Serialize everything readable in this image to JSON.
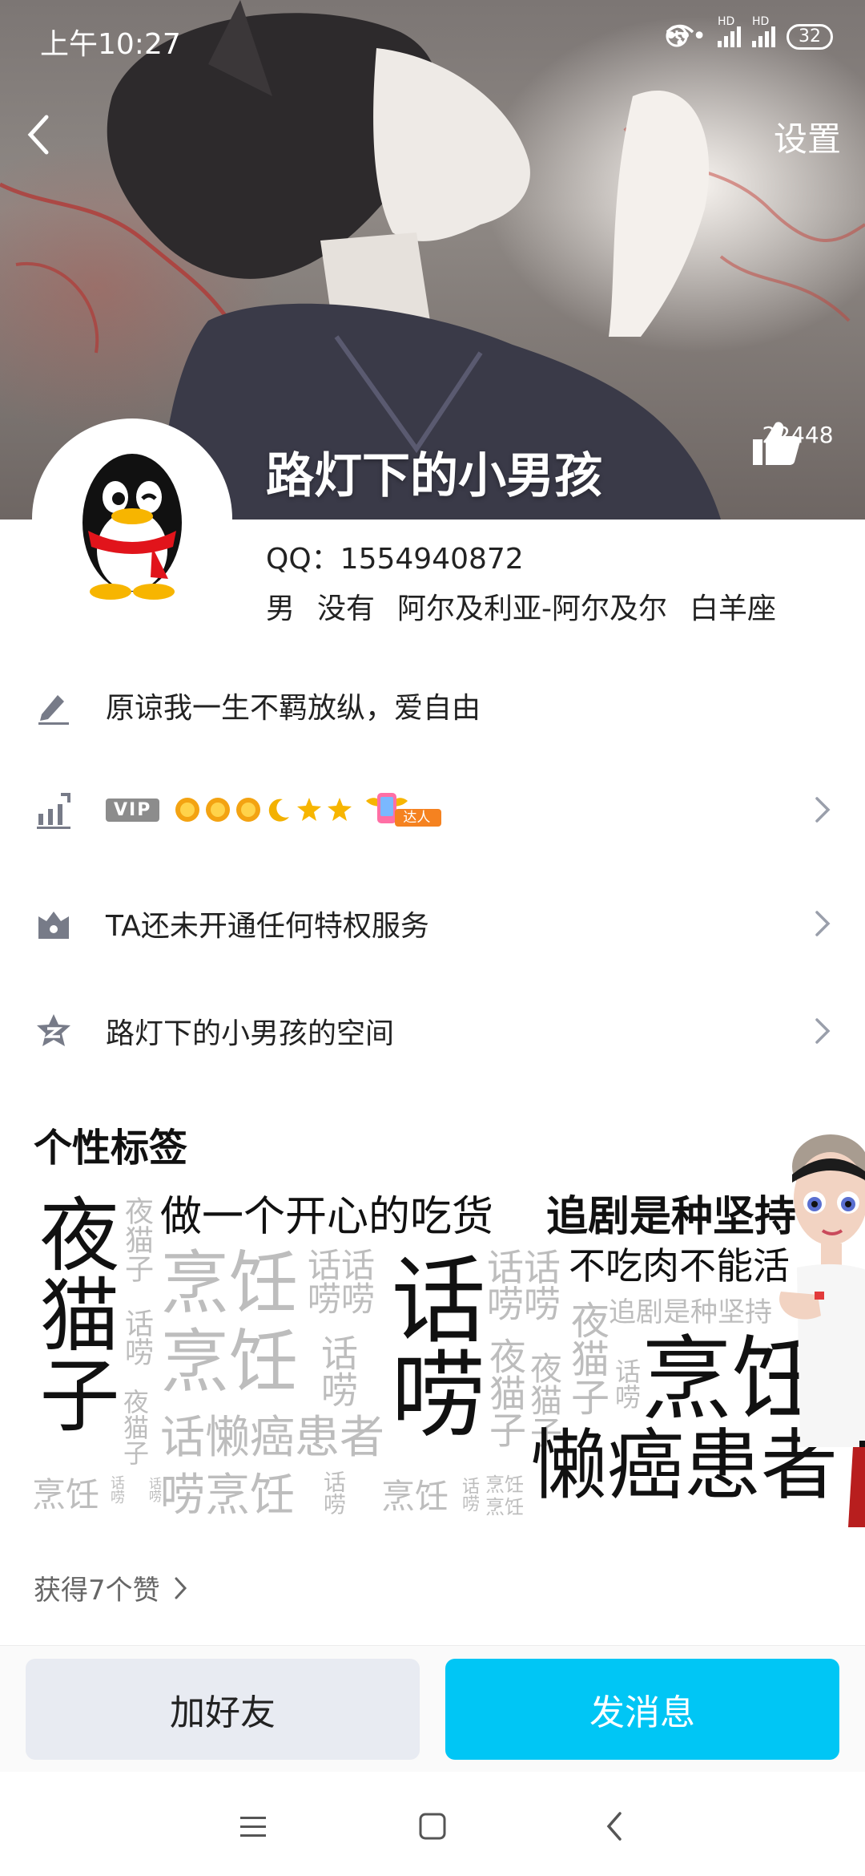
{
  "status_bar": {
    "time": "上午10:27",
    "dots": "•••",
    "signal_1": "HD",
    "signal_2": "HD",
    "battery": "32"
  },
  "header": {
    "settings_label": "设置"
  },
  "profile": {
    "name": "路灯下的小男孩",
    "likes": "22448",
    "qq_label": "QQ：1554940872",
    "gender": "男",
    "status": "没有",
    "location": "阿尔及利亚-阿尔及尔",
    "zodiac": "白羊座"
  },
  "rows": {
    "signature": "原谅我一生不羁放纵，爱自由",
    "vip_badge": "VIP",
    "daren_badge": "达人",
    "privilege": "TA还未开通任何特权服务",
    "space": "路灯下的小男孩的空间"
  },
  "tags": {
    "title": "个性标签",
    "words": {
      "w1": "夜猫子",
      "w2": "夜猫子",
      "w3": "做一个开心的吃货",
      "w4": "追剧是种坚持",
      "w5": "烹饪",
      "w6": "话话唠唠",
      "w7": "话唠",
      "w8": "话话唠唠",
      "w9": "不吃肉不能活",
      "w10": "话唠",
      "w11": "夜猫子",
      "w12": "追剧是种坚持",
      "w13": "烹饪",
      "w14": "话唠",
      "w15": "夜猫子",
      "w16": "烹饪",
      "w17": "话唠",
      "w18": "夜猫子",
      "w19": "话懒癌患者",
      "w20": "夜猫子",
      "w21": "懒癌患者",
      "w22": "烹饪",
      "w23": "话唠",
      "w24": "唠烹饪",
      "w25": "话唠",
      "w26": "烹饪",
      "w27": "话唠",
      "w28": "烹饪",
      "w29": "烹饪",
      "w30": "话唠"
    }
  },
  "likes_link": "获得7个赞",
  "actions": {
    "add_friend": "加好友",
    "send_message": "发消息"
  }
}
